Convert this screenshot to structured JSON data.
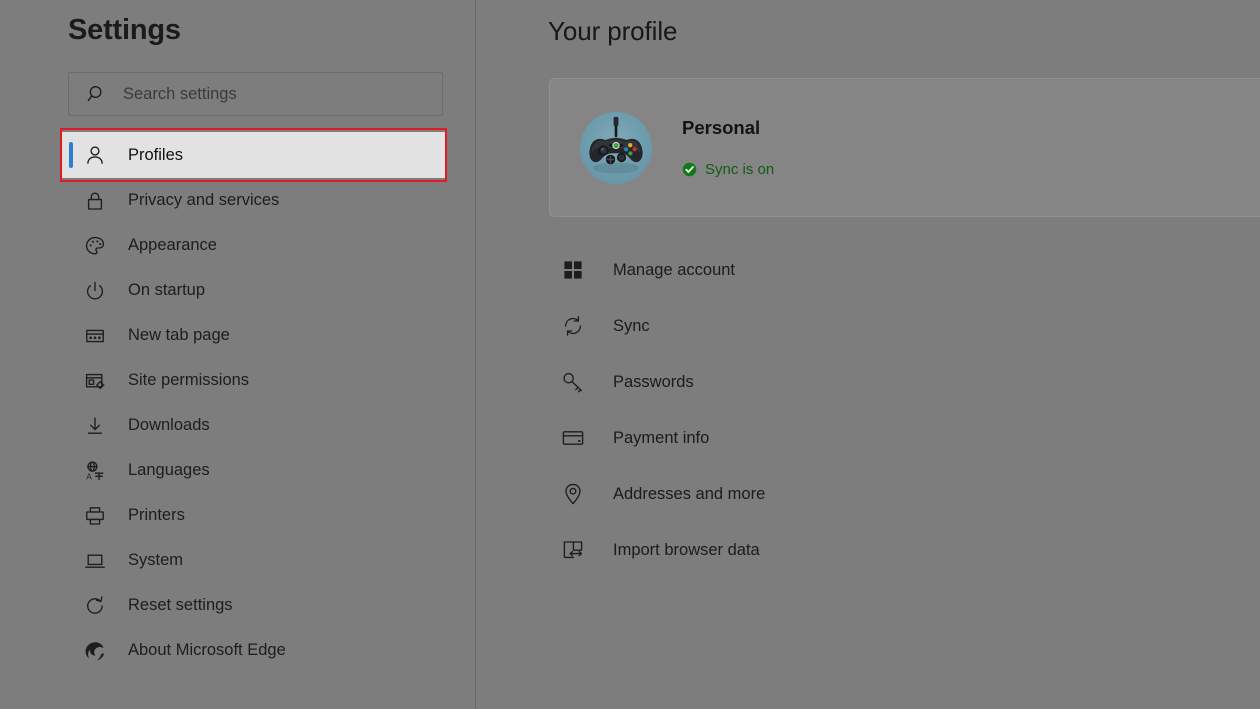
{
  "sidebar": {
    "title": "Settings",
    "search": {
      "placeholder": "Search settings",
      "value": "",
      "icon": "search-icon"
    },
    "items": [
      {
        "label": "Profiles",
        "icon": "person-icon",
        "selected": true,
        "annotated": true
      },
      {
        "label": "Privacy and services",
        "icon": "lock-icon",
        "selected": false,
        "annotated": false
      },
      {
        "label": "Appearance",
        "icon": "palette-icon",
        "selected": false,
        "annotated": false
      },
      {
        "label": "On startup",
        "icon": "power-icon",
        "selected": false,
        "annotated": false
      },
      {
        "label": "New tab page",
        "icon": "new-tab-icon",
        "selected": false,
        "annotated": false
      },
      {
        "label": "Site permissions",
        "icon": "site-settings-icon",
        "selected": false,
        "annotated": false
      },
      {
        "label": "Downloads",
        "icon": "download-icon",
        "selected": false,
        "annotated": false
      },
      {
        "label": "Languages",
        "icon": "globe-language-icon",
        "selected": false,
        "annotated": false
      },
      {
        "label": "Printers",
        "icon": "printer-icon",
        "selected": false,
        "annotated": false
      },
      {
        "label": "System",
        "icon": "laptop-icon",
        "selected": false,
        "annotated": false
      },
      {
        "label": "Reset settings",
        "icon": "reset-icon",
        "selected": false,
        "annotated": false
      },
      {
        "label": "About Microsoft Edge",
        "icon": "edge-logo-icon",
        "selected": false,
        "annotated": false
      }
    ]
  },
  "main": {
    "title": "Your profile",
    "profile_card": {
      "name": "Personal",
      "avatar_icon": "game-controller-avatar",
      "sync_status": "Sync is on",
      "sync_icon": "check-circle-icon"
    },
    "actions": [
      {
        "label": "Manage account",
        "icon": "grid-icon"
      },
      {
        "label": "Sync",
        "icon": "sync-icon"
      },
      {
        "label": "Passwords",
        "icon": "key-icon"
      },
      {
        "label": "Payment info",
        "icon": "credit-card-icon"
      },
      {
        "label": "Addresses and more",
        "icon": "location-pin-icon"
      },
      {
        "label": "Import browser data",
        "icon": "import-icon"
      }
    ]
  },
  "colors": {
    "page_background": "#7d7d7d",
    "selected_row": "#e2e2e2",
    "selection_accent": "#2b7cd3",
    "annotation_outline": "#e01b24",
    "sync_on_green": "#0d5e13",
    "text": "#1d1d1d"
  }
}
